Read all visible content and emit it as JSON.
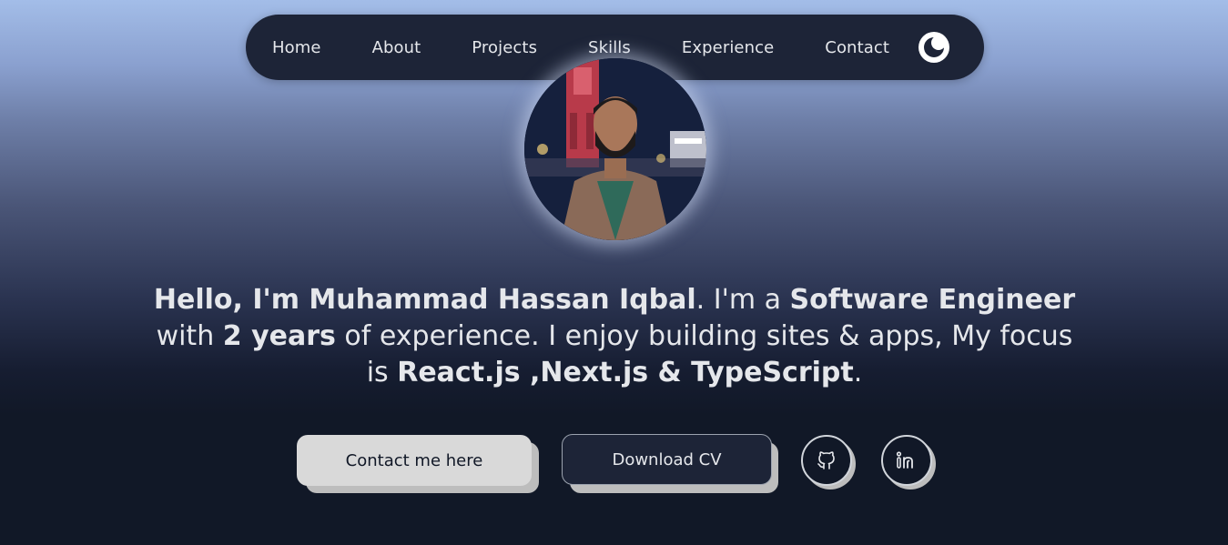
{
  "nav": {
    "items": [
      {
        "label": "Home"
      },
      {
        "label": "About"
      },
      {
        "label": "Projects"
      },
      {
        "label": "Skills"
      },
      {
        "label": "Experience"
      },
      {
        "label": "Contact"
      }
    ],
    "theme_toggle_icon": "theme-toggle-icon"
  },
  "hero": {
    "segments": {
      "s1": "Hello, I'm Muhammad Hassan Iqbal",
      "s2": ". I'm a ",
      "s3": "Software Engineer",
      "s4": " with ",
      "s5": "2 years",
      "s6": " of experience. I enjoy building sites & apps, My focus is ",
      "s7": "React.js ,Next.js & TypeScript",
      "s8": "."
    }
  },
  "actions": {
    "contact_label": "Contact me here",
    "cv_label": "Download CV",
    "github_icon": "github-icon",
    "linkedin_icon": "linkedin-icon"
  },
  "colors": {
    "nav_bg": "#1d2437",
    "page_bg": "#111827",
    "contact_btn_bg": "#d9d9d9"
  }
}
